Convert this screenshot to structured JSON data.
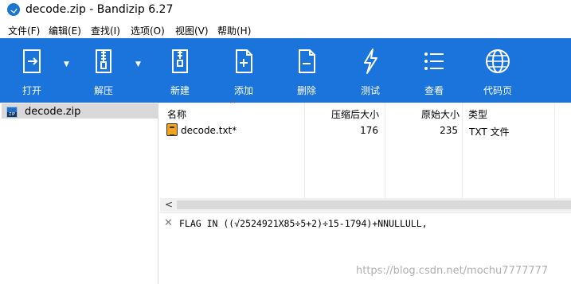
{
  "window": {
    "title": "decode.zip - Bandizip 6.27"
  },
  "menu": [
    "文件(F)",
    "编辑(E)",
    "查找(I)",
    "选项(O)",
    "视图(V)",
    "帮助(H)"
  ],
  "toolbar": {
    "color": "#1b74dc",
    "buttons": [
      {
        "label": "打开",
        "icon": "open-folder-icon"
      },
      {
        "label": "解压",
        "icon": "extract-zipper-icon"
      },
      {
        "label": "新建",
        "icon": "new-archive-icon"
      },
      {
        "label": "添加",
        "icon": "add-file-icon"
      },
      {
        "label": "删除",
        "icon": "delete-file-icon"
      },
      {
        "label": "测试",
        "icon": "test-lightning-icon"
      },
      {
        "label": "查看",
        "icon": "view-list-icon"
      },
      {
        "label": "代码页",
        "icon": "codepage-globe-icon"
      }
    ]
  },
  "sidebar": {
    "items": [
      {
        "label": "decode.zip",
        "icon": "zip-archive-icon"
      }
    ]
  },
  "list": {
    "columns": [
      "名称",
      "压缩后大小",
      "原始大小",
      "类型"
    ],
    "rows": [
      {
        "name": "decode.txt*",
        "packed": "176",
        "original": "235",
        "type": "TXT 文件",
        "icon": "text-file-icon"
      }
    ]
  },
  "comment": {
    "text": "FLAG IN ((√2524921X85÷5+2)÷15-1794)+NNULLULL,"
  },
  "watermark": "https://blog.csdn.net/mochu7777777"
}
